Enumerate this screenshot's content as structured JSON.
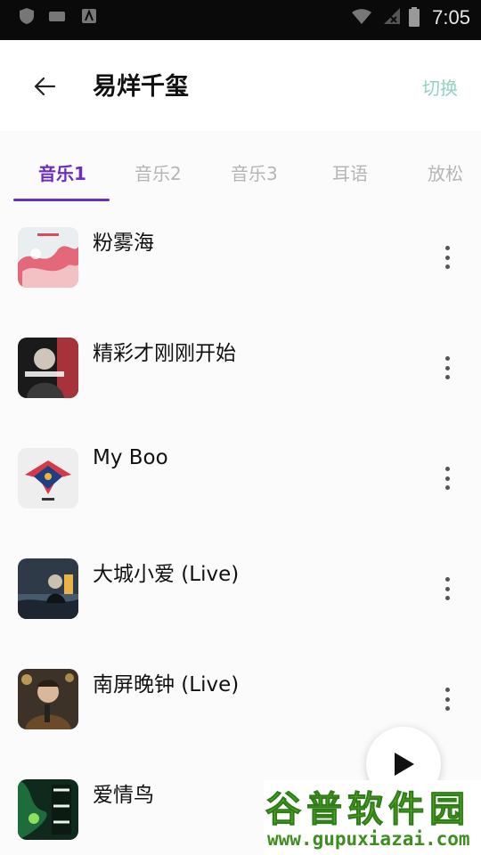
{
  "status_bar": {
    "time": "7:05"
  },
  "header": {
    "title": "易烊千玺",
    "switch_label": "切换"
  },
  "tabs": [
    {
      "label": "音乐1",
      "active": true
    },
    {
      "label": "音乐2",
      "active": false
    },
    {
      "label": "音乐3",
      "active": false
    },
    {
      "label": "耳语",
      "active": false
    },
    {
      "label": "放松",
      "active": false
    }
  ],
  "songs": [
    {
      "title": "粉雾海"
    },
    {
      "title": "精彩才刚刚开始"
    },
    {
      "title": "My Boo"
    },
    {
      "title": "大城小爱 (Live)"
    },
    {
      "title": "南屏晚钟 (Live)"
    },
    {
      "title": "爱情鸟"
    }
  ],
  "watermark": {
    "text": "谷普软件园",
    "url": "www.gupuxiazai.com"
  },
  "colors": {
    "accent": "#6a2fc0",
    "switch": "#8fd4c0",
    "watermark": "#62b52f"
  }
}
